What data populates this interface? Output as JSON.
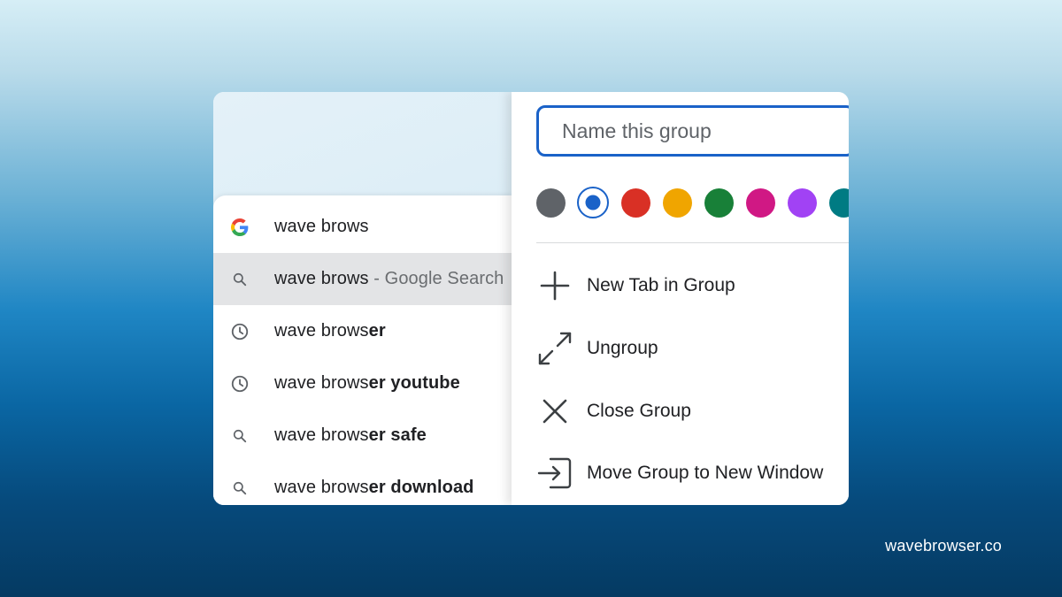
{
  "omnibox": {
    "suggestions": [
      {
        "icon": "google-g-icon",
        "prefix": "wave brows",
        "bold": "",
        "suffix": ""
      },
      {
        "icon": "search-icon",
        "prefix": "wave brows",
        "bold": "",
        "suffix": " - Google Search"
      },
      {
        "icon": "history-clock-icon",
        "prefix": "wave brows",
        "bold": "er",
        "suffix": ""
      },
      {
        "icon": "history-clock-icon",
        "prefix": "wave brows",
        "bold": "er youtube",
        "suffix": ""
      },
      {
        "icon": "search-icon",
        "prefix": "wave brows",
        "bold": "er safe",
        "suffix": ""
      },
      {
        "icon": "search-icon",
        "prefix": "wave brows",
        "bold": "er download",
        "suffix": ""
      }
    ]
  },
  "group_menu": {
    "name_placeholder": "Name this group",
    "colors": [
      "#5f6368",
      "#1a62c8",
      "#d93025",
      "#f0a500",
      "#188038",
      "#d01884",
      "#a142f4",
      "#007b83"
    ],
    "selected_color_index": 1,
    "items": [
      {
        "icon": "plus-icon",
        "label": "New Tab in Group"
      },
      {
        "icon": "ungroup-arrows-icon",
        "label": "Ungroup"
      },
      {
        "icon": "close-x-icon",
        "label": "Close Group"
      },
      {
        "icon": "move-window-icon",
        "label": "Move Group to New Window"
      }
    ]
  },
  "watermark": "wavebrowser.co"
}
